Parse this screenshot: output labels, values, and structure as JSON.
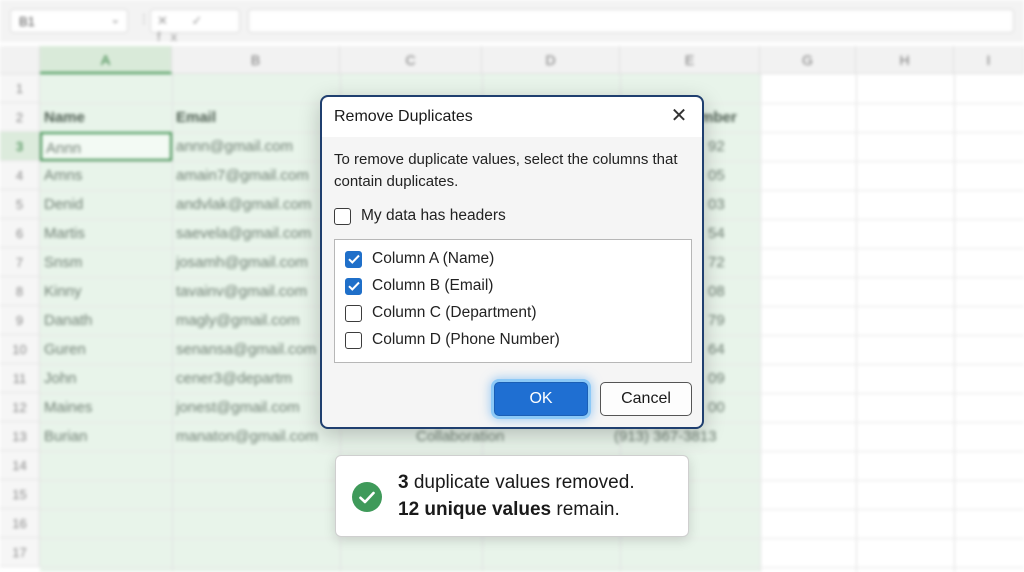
{
  "formula_bar": {
    "name_box": "B1",
    "fx_symbols": "✕ ✓ fx",
    "formula_value": ""
  },
  "sheet": {
    "columns": [
      "A",
      "B",
      "C",
      "D",
      "E",
      "G",
      "H",
      "I"
    ],
    "rows": [
      "1",
      "2",
      "3",
      "4",
      "5",
      "6",
      "7",
      "8",
      "9",
      "10",
      "11",
      "12",
      "13",
      "14",
      "15",
      "16",
      "17"
    ],
    "header_row": [
      "Name",
      "Email",
      "mber"
    ],
    "data": [
      {
        "name": "Annn",
        "email": "annn@gmail.com",
        "phone": "92"
      },
      {
        "name": "Amns",
        "email": "amain7@gmail.com",
        "phone": "05"
      },
      {
        "name": "Denid",
        "email": "andvlak@gmail.com",
        "phone": "03"
      },
      {
        "name": "Martis",
        "email": "saevela@gmail.com",
        "phone": "54"
      },
      {
        "name": "Snsm",
        "email": "josamh@gmail.com",
        "phone": "72"
      },
      {
        "name": "Kinny",
        "email": "tavainv@gmail.com",
        "phone": "08"
      },
      {
        "name": "Danath",
        "email": "magly@gmail.com",
        "phone": "79"
      },
      {
        "name": "Guren",
        "email": "senansa@gmail.com",
        "phone": "64"
      },
      {
        "name": "John",
        "email": "cener3@departm",
        "phone": "09"
      },
      {
        "name": "Maines",
        "email": "jonest@gmail.com",
        "phone": "00"
      },
      {
        "name": "Burian",
        "email": "manaton@gmail.com",
        "department": "Collaboration",
        "phone": "(913) 367-3813"
      }
    ]
  },
  "dialog": {
    "title": "Remove Duplicates",
    "close_symbol": "✕",
    "instructions": "To remove duplicate values, select the columns that contain duplicates.",
    "headers_checkbox": {
      "label": "My data has headers",
      "checked": false
    },
    "columns": [
      {
        "label": "Column A (Name)",
        "checked": true
      },
      {
        "label": "Column B (Email)",
        "checked": true
      },
      {
        "label": "Column C (Department)",
        "checked": false
      },
      {
        "label": "Column D (Phone Number)",
        "checked": false
      }
    ],
    "ok_label": "OK",
    "cancel_label": "Cancel"
  },
  "toast": {
    "removed_count": "3",
    "removed_text": " duplicate values removed.",
    "unique_count_text": "12 unique values",
    "unique_suffix": " remain."
  },
  "colors": {
    "accent": "#1f6fd2",
    "success": "#3f9a5a",
    "selection": "#e8f4ea"
  }
}
